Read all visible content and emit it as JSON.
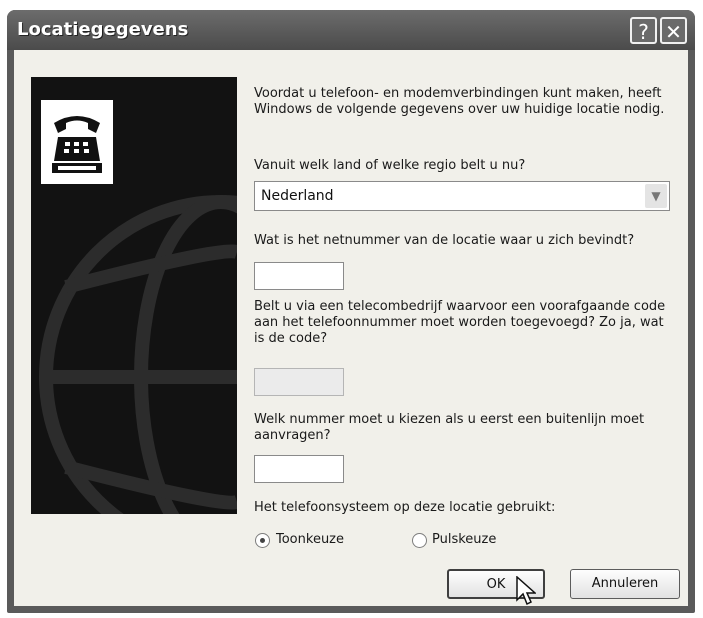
{
  "window": {
    "title": "Locatiegegevens"
  },
  "titlebar_buttons": {
    "help": "?",
    "close": "✕"
  },
  "intro": "Voordat u telefoon- en modemverbindingen kunt maken, heeft Windows de volgende gegevens over uw huidige locatie nodig.",
  "country": {
    "label": "Vanuit welk land of welke regio belt u nu?",
    "value": "Nederland"
  },
  "area_code": {
    "label": "Wat is het netnummer van de locatie waar u zich bevindt?",
    "value": ""
  },
  "carrier_code": {
    "label": "Belt u via een telecombedrijf waarvoor een voorafgaande code aan het telefoonnummer moet worden toegevoegd? Zo ja, wat is de code?",
    "value": ""
  },
  "outside_line": {
    "label": "Welk nummer moet u kiezen als u eerst een buitenlijn moet aanvragen?",
    "value": ""
  },
  "dialing": {
    "label": "Het telefoonsysteem op deze locatie gebruikt:",
    "options": [
      "Toonkeuze",
      "Pulskeuze"
    ],
    "selected": "Toonkeuze"
  },
  "buttons": {
    "ok": "OK",
    "cancel": "Annuleren"
  },
  "icons": {
    "panel_icon": "telephone-icon",
    "cursor": "mouse-pointer-icon"
  }
}
